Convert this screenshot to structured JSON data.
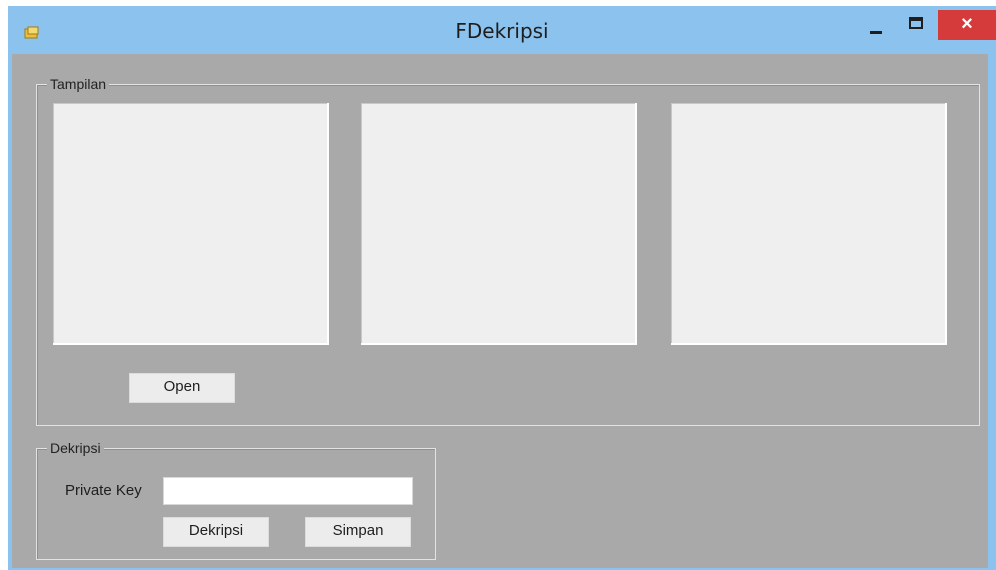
{
  "window": {
    "title": "FDekripsi",
    "close_glyph": "×",
    "minimize_icon": "minimize-icon",
    "maximize_icon": "maximize-icon",
    "app_icon": "app-icon"
  },
  "tampilan": {
    "label": "Tampilan",
    "open_label": "Open"
  },
  "dekripsi": {
    "label": "Dekripsi",
    "private_key_label": "Private Key",
    "private_key_value": "",
    "dekripsi_label": "Dekripsi",
    "simpan_label": "Simpan"
  },
  "colors": {
    "titlebar": "#8cc2ee",
    "close_button": "#d63b3b",
    "client_background": "#a9a9a9",
    "picture_box": "#efefef"
  }
}
